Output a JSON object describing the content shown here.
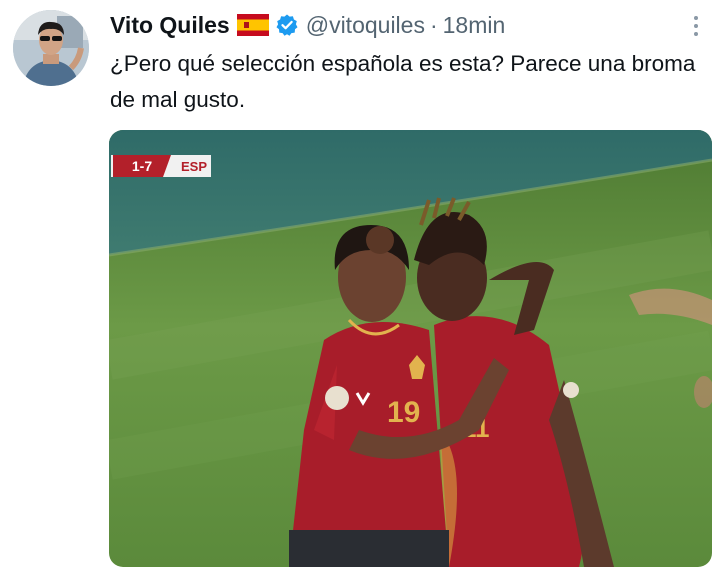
{
  "tweet": {
    "author_name": "Vito Quiles",
    "handle": "@vitoquiles",
    "separator": "·",
    "time": "18min",
    "text": "¿Pero qué selección española es esta? Parece una broma de mal gusto."
  },
  "media": {
    "score": "1-7",
    "team": "ESP",
    "jersey_left": "19",
    "jersey_right": "11"
  },
  "colors": {
    "verified": "#1d9bf0",
    "pitch": "#5e8a3d",
    "kit": "#a81d2a",
    "score_bg": "#b3202a"
  },
  "icons": {
    "verified": "verified-badge-icon",
    "flag": "spain-flag-icon",
    "more": "more-options-icon"
  }
}
